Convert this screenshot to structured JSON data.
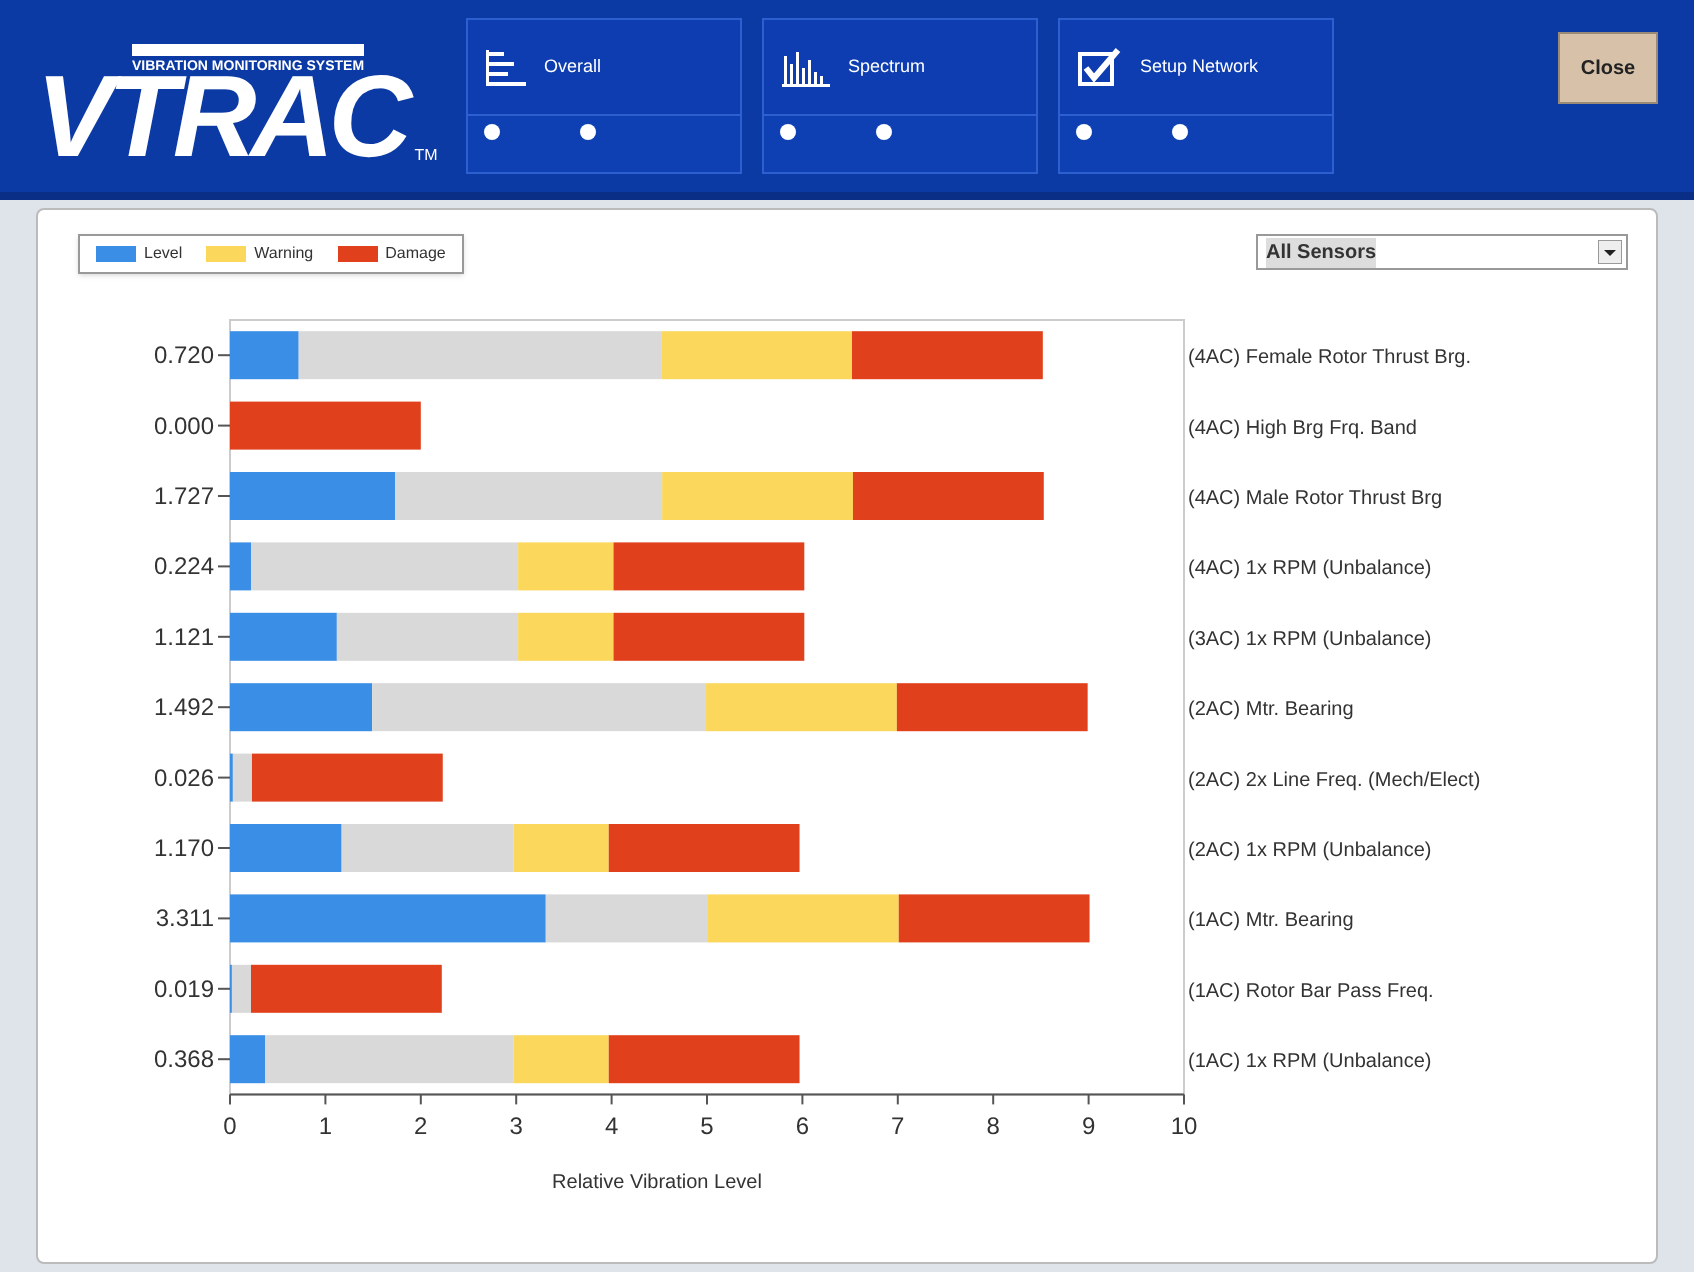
{
  "logo": {
    "wordmark": "VTRAC",
    "tagline": "VIBRATION MONITORING SYSTEM",
    "trademark": "TM"
  },
  "nav": [
    {
      "label": "Overall",
      "radios": [
        {
          "selected": false
        },
        {
          "selected": false
        }
      ]
    },
    {
      "label": "Spectrum",
      "radios": [
        {
          "selected": false
        },
        {
          "selected": false
        }
      ]
    },
    {
      "label": "Setup Network",
      "radios": [
        {
          "selected": false
        },
        {
          "selected": false
        }
      ]
    }
  ],
  "close_button": "Close",
  "sensor_select": {
    "value": "All Sensors"
  },
  "chart": {
    "chart_data": {
      "type": "bar",
      "orientation": "horizontal",
      "stacked": true,
      "xlabel": "Relative Vibration Level",
      "xlim": [
        0,
        10
      ],
      "xticks": [
        0,
        1,
        2,
        3,
        4,
        5,
        6,
        7,
        8,
        9,
        10
      ],
      "categories": [
        "0.720",
        "0.000",
        "1.727",
        "0.224",
        "1.121",
        "1.492",
        "0.026",
        "1.170",
        "3.311",
        "0.019",
        "0.368"
      ],
      "series": [
        {
          "name": "Level",
          "color": "#3b8ee6",
          "values": [
            0.72,
            0,
            1.73,
            0.22,
            1.12,
            1.49,
            0.03,
            1.17,
            3.31,
            0.02,
            0.37
          ]
        },
        {
          "color": "#d9d9d9",
          "values": [
            3.8,
            0,
            2.8,
            2.8,
            1.9,
            3.5,
            0.2,
            1.8,
            1.7,
            0.2,
            2.6
          ]
        },
        {
          "name": "Warning",
          "color": "#fbd75b",
          "values": [
            2,
            0,
            2,
            1,
            1,
            2,
            0,
            1,
            2,
            0,
            1
          ]
        },
        {
          "name": "Damage",
          "color": "#e0401c",
          "values": [
            2,
            2,
            2,
            2,
            2,
            2,
            2,
            2,
            2,
            2,
            2
          ]
        }
      ]
    },
    "row_labels": [
      "(4AC) Female Rotor Thrust Brg.",
      "(4AC) High Brg Frq. Band",
      "(4AC) Male Rotor Thrust Brg",
      "(4AC) 1x RPM (Unbalance)",
      "(3AC) 1x RPM (Unbalance)",
      "(2AC) Mtr. Bearing",
      "(2AC) 2x Line Freq. (Mech/Elect)",
      "(2AC) 1x RPM (Unbalance)",
      "(1AC) Mtr. Bearing",
      "(1AC) Rotor Bar Pass Freq.",
      "(1AC) 1x RPM (Unbalance)"
    ]
  }
}
